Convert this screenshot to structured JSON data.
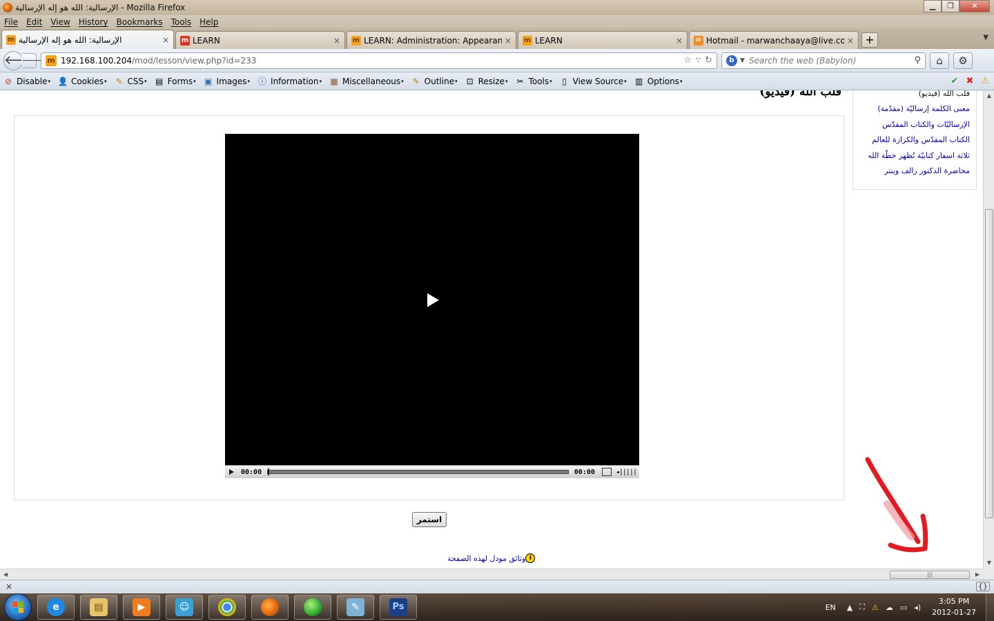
{
  "window": {
    "title": "الإرسالية: الله هو إله الإرسالية - Mozilla Firefox",
    "minimize_label": "▁",
    "maximize_label": "❐",
    "close_label": "✕"
  },
  "menu": {
    "items": [
      "File",
      "Edit",
      "View",
      "History",
      "Bookmarks",
      "Tools",
      "Help"
    ]
  },
  "tabs": [
    {
      "label": "الإرسالية: الله هو إله الإرسالية",
      "icon": "moodle-icon",
      "active": true
    },
    {
      "label": "LEARN",
      "icon": "moodle-red-icon",
      "active": false
    },
    {
      "label": "LEARN: Administration: Appearance: ...",
      "icon": "moodle-icon",
      "active": false
    },
    {
      "label": "LEARN",
      "icon": "moodle-icon",
      "active": false
    },
    {
      "label": "Hotmail - marwanchaaya@live.com",
      "icon": "hotmail-icon",
      "active": false
    }
  ],
  "tabs_new_label": "+",
  "tab_close_label": "×",
  "nav": {
    "back_label": "🡐",
    "forward_label": "🡒",
    "url_host": "192.168.100.204",
    "url_path": "/mod/lesson/view.php?id=233",
    "search_placeholder": "Search the web (Babylon)",
    "home_label": "⌂"
  },
  "devtoolbar": {
    "items": [
      {
        "label": "Disable",
        "icon": "disable-icon"
      },
      {
        "label": "Cookies",
        "icon": "cookies-icon"
      },
      {
        "label": "CSS",
        "icon": "css-icon"
      },
      {
        "label": "Forms",
        "icon": "forms-icon"
      },
      {
        "label": "Images",
        "icon": "images-icon"
      },
      {
        "label": "Information",
        "icon": "information-icon"
      },
      {
        "label": "Miscellaneous",
        "icon": "miscellaneous-icon"
      },
      {
        "label": "Outline",
        "icon": "outline-icon"
      },
      {
        "label": "Resize",
        "icon": "resize-icon"
      },
      {
        "label": "Tools",
        "icon": "tools-icon"
      },
      {
        "label": "View Source",
        "icon": "view-source-icon"
      },
      {
        "label": "Options",
        "icon": "options-icon"
      }
    ]
  },
  "page": {
    "lesson_title": "قلب الله (فيديو)",
    "player": {
      "current_time": "00:00",
      "duration": "00:00",
      "progress": 0
    },
    "continue_label": "استمر",
    "docs_link": "وثائق مودل لهذه الصفحة",
    "side_menu": {
      "current": "قلب الله (فيديو)",
      "links": [
        "معنى الكلمة إرساليّة (مقدّمة)",
        "الإرساليّات والكتاب المقدّس",
        "الكتاب المقدّس والكرازة للعالم",
        "ثلاثة اسفار كتابيّة تُظهر خطّة الله",
        "محاضرة الدكتور رالف وينتر"
      ]
    }
  },
  "addonbar": {
    "close_label": "×",
    "brace_label": "{}"
  },
  "taskbar": {
    "apps": [
      {
        "name": "internet-explorer",
        "color": "#1e88e5",
        "glyph": "e"
      },
      {
        "name": "file-explorer",
        "color": "#e7c36a",
        "glyph": "▤"
      },
      {
        "name": "media-player",
        "color": "#f07c1e",
        "glyph": "▶"
      },
      {
        "name": "messenger",
        "color": "#3aa0d8",
        "glyph": "☺"
      },
      {
        "name": "chrome",
        "color": "#34a853",
        "glyph": "◎"
      },
      {
        "name": "firefox",
        "color": "#e66000",
        "glyph": "◉"
      },
      {
        "name": "green-app",
        "color": "#2fae2f",
        "glyph": "●"
      },
      {
        "name": "notepad",
        "color": "#7fb3d5",
        "glyph": "✎"
      },
      {
        "name": "photoshop",
        "color": "#1c3f8a",
        "glyph": "Ps"
      }
    ],
    "language": "EN",
    "time": "3:05 PM",
    "date": "2012-01-27"
  },
  "colors": {
    "link": "#0000cc",
    "annotation_arrow": "#e11b22"
  }
}
